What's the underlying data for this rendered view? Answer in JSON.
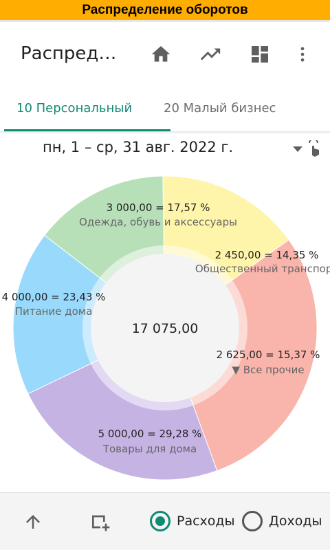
{
  "window": {
    "title": "Распределение оборотов"
  },
  "appbar": {
    "title": "Распред…",
    "icons": [
      "home-icon",
      "trending-up-icon",
      "dashboard-icon",
      "more-vert-icon"
    ]
  },
  "tabs": [
    {
      "label": "10 Персональный",
      "active": true
    },
    {
      "label": "20 Малый бизнес",
      "active": false
    }
  ],
  "date_range": {
    "label": "пн, 1 – ср, 31 авг. 2022 г."
  },
  "chart_data": {
    "type": "pie",
    "total": "17 075,00",
    "slices": [
      {
        "value": 3000,
        "value_label": "3 000,00 = 17,57 %",
        "name": "Одежда, обувь и аксессуары",
        "color": "#99d9fb"
      },
      {
        "value": 2450,
        "value_label": "2 450,00 = 14,35 %",
        "name": "Общественный транспорт",
        "color": "#b8e0b8"
      },
      {
        "value": 2625,
        "value_label": "2 625,00 = 15,37 %",
        "name": "▼ Все прочие",
        "color": "#fff5aa"
      },
      {
        "value": 5000,
        "value_label": "5 000,00 = 29,28 %",
        "name": "Товары для дома",
        "color": "#f9b4ab"
      },
      {
        "value": 4000,
        "value_label": "4 000,00 = 23,43 %",
        "name": "Питание дома",
        "color": "#c5b3e4"
      }
    ]
  },
  "bottom": {
    "expense_label": "Расходы",
    "income_label": "Доходы",
    "selected": "expense"
  },
  "colors": {
    "accent": "#118a74",
    "titlebar": "#ffad00"
  }
}
